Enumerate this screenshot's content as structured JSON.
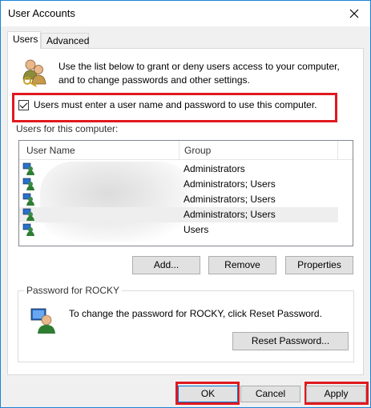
{
  "window": {
    "title": "User Accounts",
    "close_icon": "close-icon"
  },
  "tabs": [
    {
      "label": "Users",
      "active": true
    },
    {
      "label": "Advanced",
      "active": false
    }
  ],
  "intro": {
    "text": "Use the list below to grant or deny users access to your computer, and to change passwords and other settings."
  },
  "require_login": {
    "label": "Users must enter a user name and password to use this computer.",
    "checked": true
  },
  "users_section": {
    "label": "Users for this computer:",
    "columns": [
      "User Name",
      "Group"
    ],
    "rows": [
      {
        "user_name": "",
        "group": "Administrators",
        "selected": false
      },
      {
        "user_name": "",
        "group": "Administrators; Users",
        "selected": false
      },
      {
        "user_name": "",
        "group": "Administrators; Users",
        "selected": false
      },
      {
        "user_name": "",
        "group": "Administrators; Users",
        "selected": true
      },
      {
        "user_name": "",
        "group": "Users",
        "selected": false
      }
    ]
  },
  "user_buttons": {
    "add": "Add...",
    "remove": "Remove",
    "properties": "Properties"
  },
  "password_group": {
    "label": "Password for ROCKY",
    "text": "To change the password for ROCKY, click Reset Password.",
    "reset_button": "Reset Password..."
  },
  "dialog_buttons": {
    "ok": "OK",
    "cancel": "Cancel",
    "apply": "Apply"
  },
  "colors": {
    "highlight_box": "#e0191f",
    "accent": "#0078d7"
  }
}
